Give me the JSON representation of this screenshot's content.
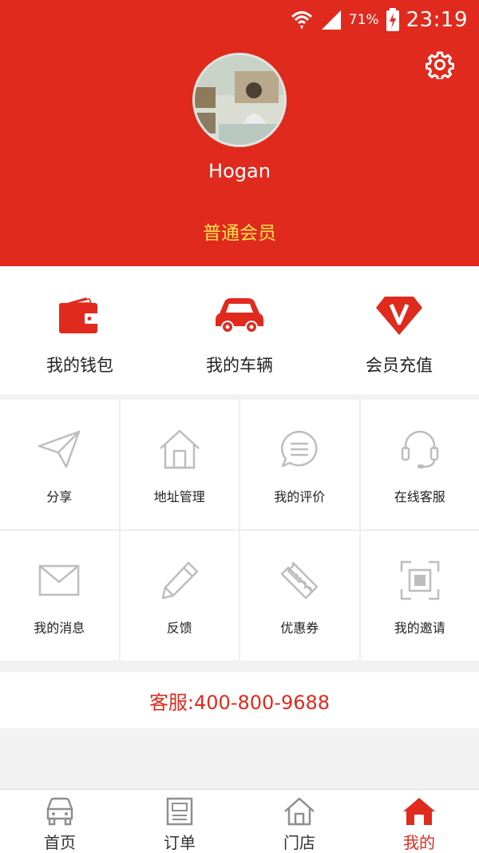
{
  "status_bar": {
    "battery_percent": "71%",
    "time": "23:19",
    "icons": [
      "wifi-icon",
      "signal-icon",
      "battery-charging-icon"
    ]
  },
  "profile": {
    "username": "Hogan",
    "member_level": "普通会员",
    "settings_icon": "gear-icon"
  },
  "quick_actions": [
    {
      "label": "我的钱包",
      "icon": "wallet-icon"
    },
    {
      "label": "我的车辆",
      "icon": "car-icon"
    },
    {
      "label": "会员充值",
      "icon": "vip-diamond-icon"
    }
  ],
  "grid": [
    {
      "label": "分享",
      "icon": "paper-plane-icon"
    },
    {
      "label": "地址管理",
      "icon": "house-icon"
    },
    {
      "label": "我的评价",
      "icon": "comment-icon"
    },
    {
      "label": "在线客服",
      "icon": "headset-icon"
    },
    {
      "label": "我的消息",
      "icon": "envelope-icon"
    },
    {
      "label": "反馈",
      "icon": "pencil-icon"
    },
    {
      "label": "优惠券",
      "icon": "ticket-icon"
    },
    {
      "label": "我的邀请",
      "icon": "scan-icon"
    }
  ],
  "hotline": "客服:400-800-9688",
  "tabs": [
    {
      "label": "首页",
      "icon": "car-outline-icon",
      "active": false
    },
    {
      "label": "订单",
      "icon": "order-icon",
      "active": false
    },
    {
      "label": "门店",
      "icon": "store-icon",
      "active": false
    },
    {
      "label": "我的",
      "icon": "home-filled-icon",
      "active": true
    }
  ],
  "colors": {
    "brand_red": "#e02a1e",
    "member_yellow": "#ffe14d",
    "icon_gray": "#bdbdbd"
  }
}
